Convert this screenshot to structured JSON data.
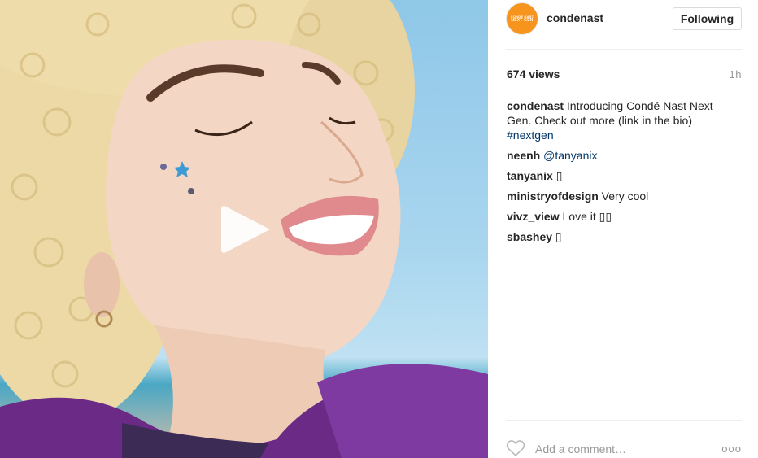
{
  "post": {
    "account": {
      "username": "condenast",
      "avatar_lines": [
        "CONDÉ NAST",
        "NEXT GEN"
      ],
      "follow_label": "Following"
    },
    "views": "674 views",
    "time": "1h",
    "caption": {
      "author": "condenast",
      "text": " Introducing Condé Nast Next Gen. Check out more (link in the bio) ",
      "hashtag": "#nextgen"
    },
    "comments": [
      {
        "author": "neenh",
        "text": " ",
        "mention": "@tanyanix"
      },
      {
        "author": "tanyanix",
        "text": " ▯"
      },
      {
        "author": "ministryofdesign",
        "text": " Very cool"
      },
      {
        "author": "vivz_view",
        "text": " Love it ▯▯"
      },
      {
        "author": "sbashey",
        "text": " ▯"
      }
    ],
    "add_comment_placeholder": "Add a comment…",
    "more_label": "ooo"
  },
  "icons": {
    "play": "play-icon",
    "heart": "heart-icon"
  },
  "colors": {
    "avatar": "#f7941d",
    "hashtag": "#003569",
    "muted": "#999999"
  }
}
